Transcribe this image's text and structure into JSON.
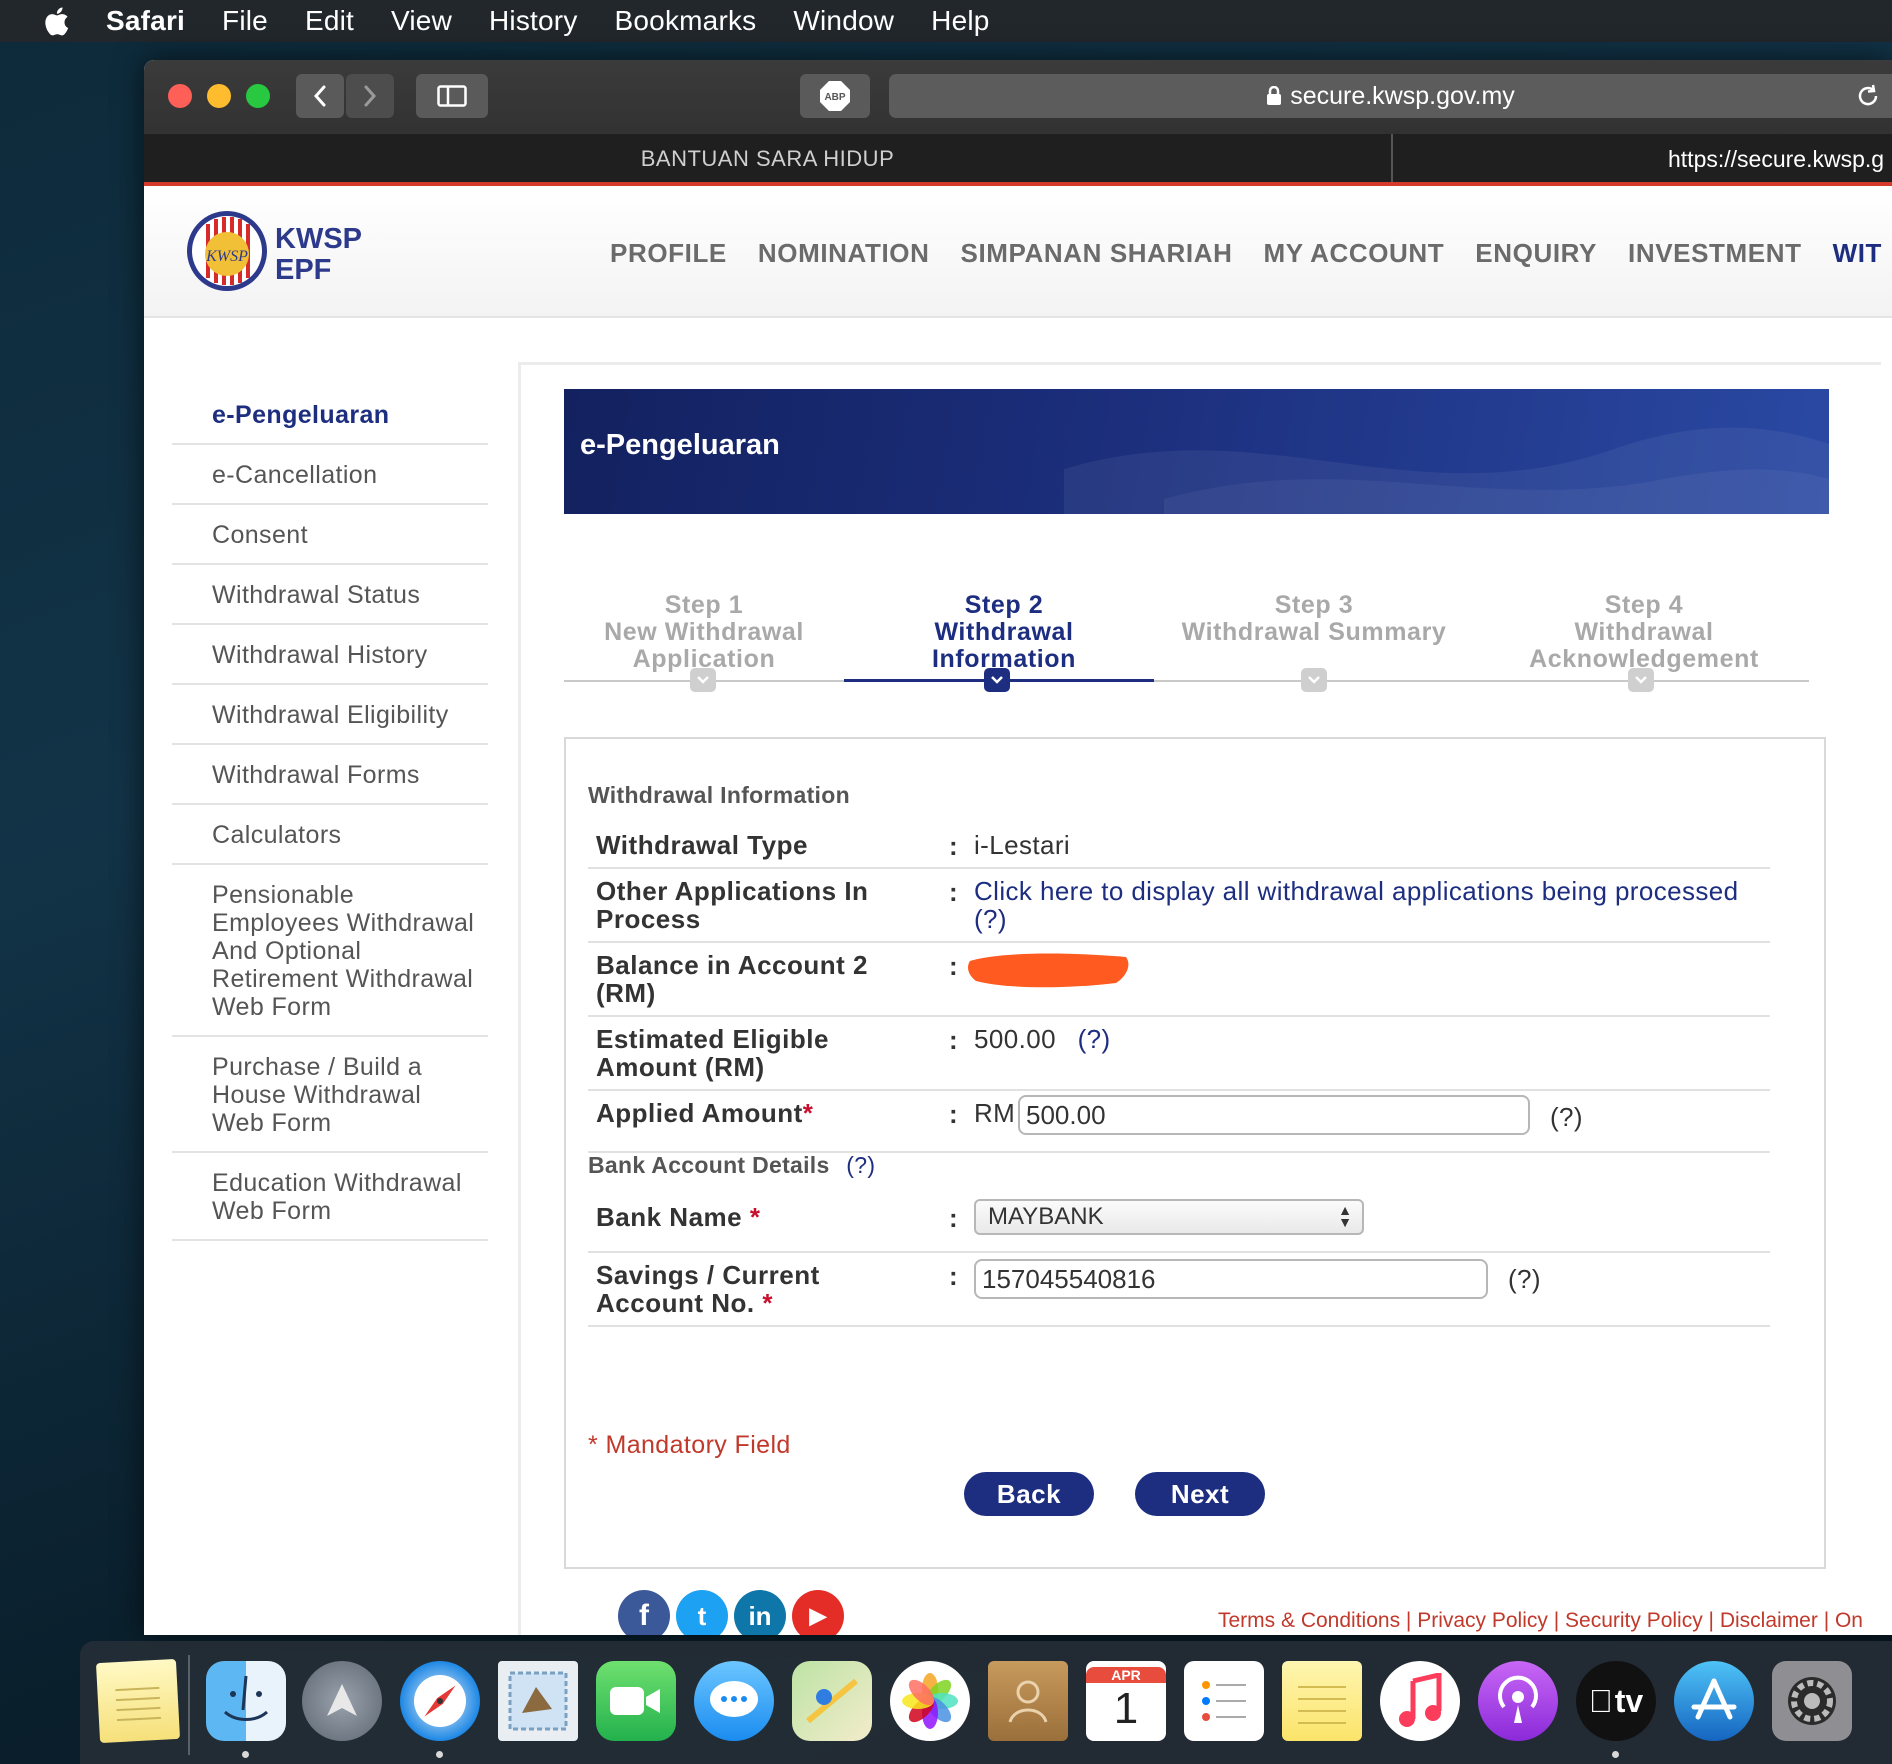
{
  "menubar": {
    "app": "Safari",
    "items": [
      "File",
      "Edit",
      "View",
      "History",
      "Bookmarks",
      "Window",
      "Help"
    ]
  },
  "browser": {
    "address": "secure.kwsp.gov.my",
    "adblock_label": "ABP",
    "tabs": [
      "BANTUAN SARA HIDUP",
      "https://secure.kwsp.g"
    ]
  },
  "site": {
    "logo_line1": "KWSP",
    "logo_line2": "EPF",
    "logo_emblem_text": "KWSP",
    "nav": [
      "PROFILE",
      "NOMINATION",
      "SIMPANAN SHARIAH",
      "MY ACCOUNT",
      "ENQUIRY",
      "INVESTMENT",
      "WIT"
    ]
  },
  "sidebar": {
    "items": [
      "e-Pengeluaran",
      "e-Cancellation",
      "Consent",
      "Withdrawal Status",
      "Withdrawal History",
      "Withdrawal Eligibility",
      "Withdrawal Forms",
      "Calculators",
      "Pensionable Employees Withdrawal And Optional Retirement Withdrawal Web Form",
      "Purchase / Build a House Withdrawal Web Form",
      "Education Withdrawal Web Form"
    ]
  },
  "banner": {
    "title": "e-Pengeluaran"
  },
  "steps": [
    {
      "num": "Step 1",
      "name": "New Withdrawal Application"
    },
    {
      "num": "Step 2",
      "name": "Withdrawal Information"
    },
    {
      "num": "Step 3",
      "name": "Withdrawal Summary"
    },
    {
      "num": "Step 4",
      "name": "Withdrawal Acknowledgement"
    }
  ],
  "withdrawal": {
    "section_title": "Withdrawal Information",
    "type_label": "Withdrawal Type",
    "type_value": "i-Lestari",
    "other_label": "Other Applications In Process",
    "other_link": "Click here to display all withdrawal applications being processed",
    "balance_label": "Balance in Account 2 (RM)",
    "estimated_label": "Estimated Eligible Amount (RM)",
    "estimated_value": "500.00",
    "applied_label": "Applied Amount",
    "applied_currency": "RM",
    "applied_value": "500.00",
    "help": "(?)",
    "colon": ":",
    "star": "*"
  },
  "bank": {
    "section_title": "Bank Account Details",
    "bank_label": "Bank Name",
    "bank_value": "MAYBANK",
    "account_label": "Savings / Current Account No.",
    "account_value": "157045540816"
  },
  "form": {
    "mandatory_note": "* Mandatory Field",
    "back_label": "Back",
    "next_label": "Next"
  },
  "footer": {
    "links": "Terms & Conditions | Privacy Policy | Security Policy | Disclaimer | On",
    "social": [
      "f",
      "t",
      "in",
      "▶"
    ]
  },
  "dock": {
    "calendar_month": "APR",
    "calendar_day": "1",
    "tv_label": "tv"
  },
  "colors": {
    "brand_navy": "#1d2e80",
    "accent_red": "#c0392b",
    "redaction": "#ff5a1f"
  }
}
